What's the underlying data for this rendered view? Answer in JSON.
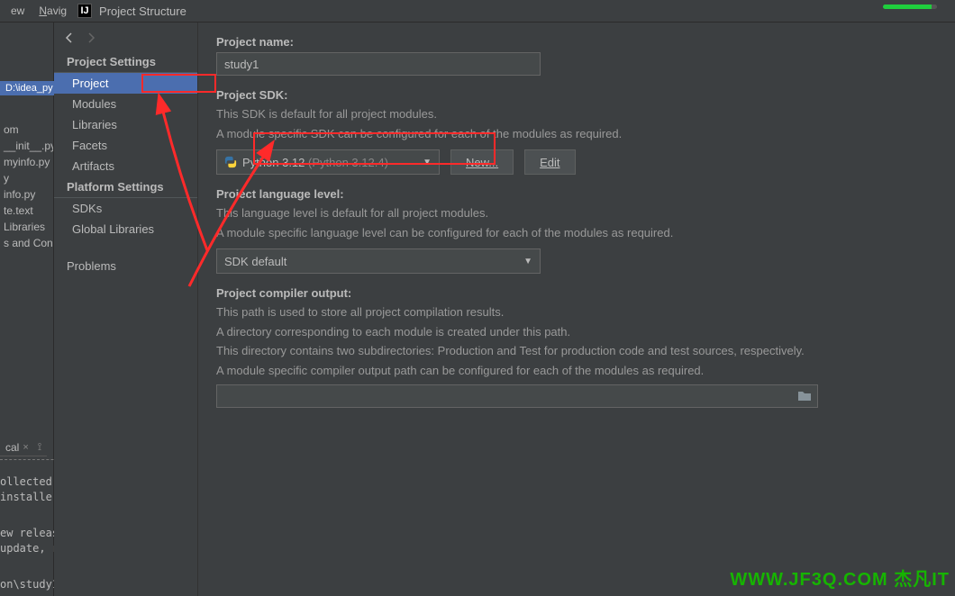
{
  "titlebar": {
    "menu_view": "ew",
    "menu_navigate": "Navigate",
    "dialog_title": "Project Structure"
  },
  "breadcrumb": "D:\\idea_py",
  "bg_files": [
    "om",
    "__init__.py",
    " myinfo.py",
    "y",
    "info.py",
    "te.text",
    "Libraries",
    "s and Con"
  ],
  "sidebar": {
    "section_project": "Project Settings",
    "section_platform": "Platform Settings",
    "items_project": [
      "Project",
      "Modules",
      "Libraries",
      "Facets",
      "Artifacts"
    ],
    "items_platform": [
      "SDKs",
      "Global Libraries"
    ],
    "problems": "Problems"
  },
  "content": {
    "project_name_label": "Project name:",
    "project_name_value": "study1",
    "project_sdk_label": "Project SDK:",
    "sdk_desc1": "This SDK is default for all project modules.",
    "sdk_desc2": "A module specific SDK can be configured for each of the modules as required.",
    "sdk_name": "Python 3.12",
    "sdk_version": "(Python 3.12.4)",
    "btn_new": "New...",
    "btn_edit": "Edit",
    "lang_level_label": "Project language level:",
    "lang_desc1": "This language level is default for all project modules.",
    "lang_desc2": "A module specific language level can be configured for each of the modules as required.",
    "lang_combo_value": "SDK default",
    "compiler_label": "Project compiler output:",
    "compiler_desc1": "This path is used to store all project compilation results.",
    "compiler_desc2": "A directory corresponding to each module is created under this path.",
    "compiler_desc3": "This directory contains two subdirectories: Production and Test for production code and test sources, respectively.",
    "compiler_desc4": "A module specific compiler output path can be configured for each of the modules as required."
  },
  "terminal": {
    "tab": "cal",
    "line1": "ollected",
    "line2": " installe",
    "line3": "ew releas",
    "line4": "update, r",
    "line5": "on\\study1"
  },
  "watermark": "WWW.JF3Q.COM 杰凡IT"
}
